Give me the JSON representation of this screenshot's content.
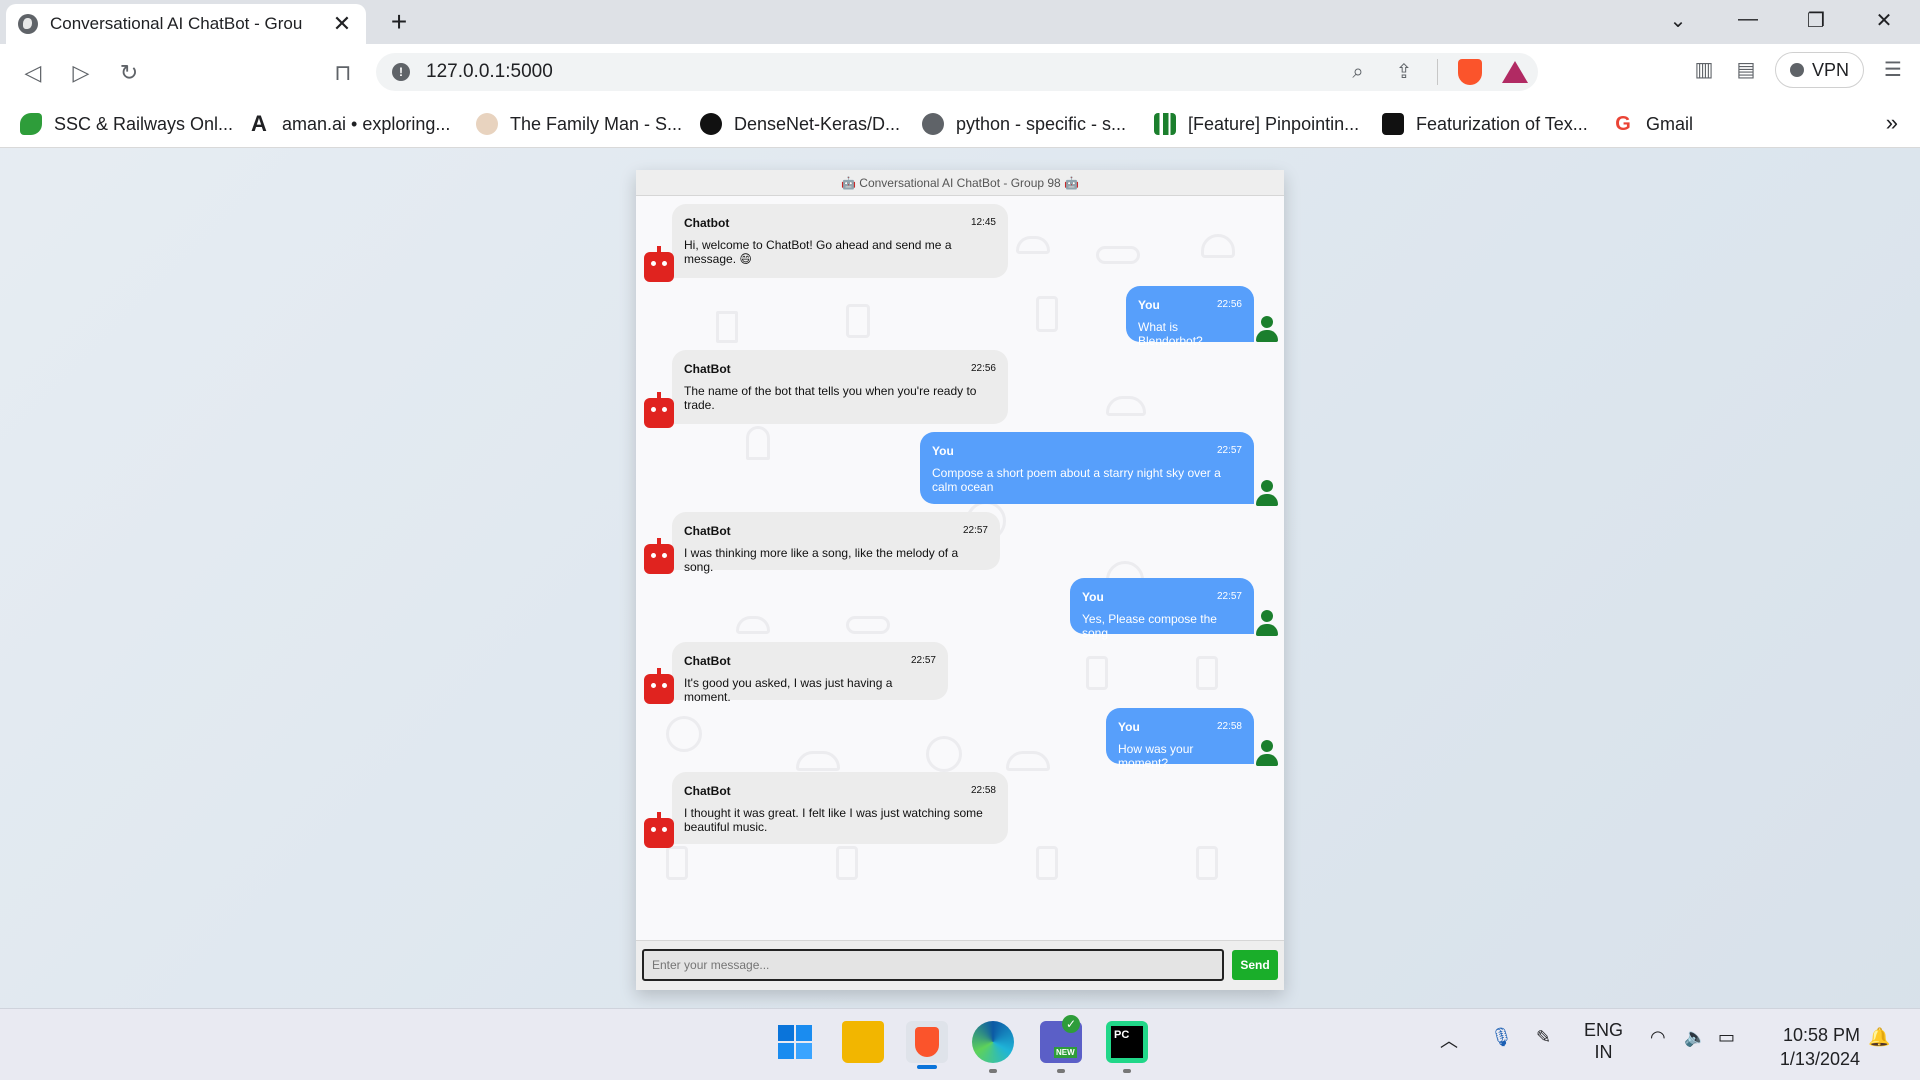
{
  "browser": {
    "tab_title": "Conversational AI ChatBot - Grou",
    "new_tab_symbol": "+",
    "url": "127.0.0.1:5000",
    "vpn_label": "VPN",
    "bookmarks": [
      {
        "label": "SSC & Railways Onl...",
        "icon": "rocket-icon",
        "color": "#2e9d3a"
      },
      {
        "label": "aman.ai • exploring...",
        "icon": "aman-logo-icon",
        "color": "#111111"
      },
      {
        "label": "The Family Man - S...",
        "icon": "family-man-icon",
        "color": "#c9a27a"
      },
      {
        "label": "DenseNet-Keras/D...",
        "icon": "github-icon",
        "color": "#111111"
      },
      {
        "label": "python - specific - s...",
        "icon": "globe-icon",
        "color": "#5f6368"
      },
      {
        "label": "[Feature] Pinpointin...",
        "icon": "bar-chart-icon",
        "color": "#1b7f2d"
      },
      {
        "label": "Featurization of Tex...",
        "icon": "medium-icon",
        "color": "#111111"
      },
      {
        "label": "Gmail",
        "icon": "google-icon",
        "color": "#ea4335"
      }
    ],
    "more_bookmarks": "»"
  },
  "chat": {
    "header": "🤖 Conversational AI ChatBot - Group 98 🤖",
    "input_placeholder": "Enter your message...",
    "send_label": "Send",
    "messages": [
      {
        "side": "left",
        "name": "Chatbot",
        "time": "12:45",
        "text": "Hi, welcome to ChatBot! Go ahead and send me a message. 😄"
      },
      {
        "side": "right",
        "name": "You",
        "time": "22:56",
        "text": "What is Blendorbot?"
      },
      {
        "side": "left",
        "name": "ChatBot",
        "time": "22:56",
        "text": "The name of the bot that tells you when you're ready to trade."
      },
      {
        "side": "right",
        "name": "You",
        "time": "22:57",
        "text": "Compose a short poem about a starry night sky over a calm ocean"
      },
      {
        "side": "left",
        "name": "ChatBot",
        "time": "22:57",
        "text": "I was thinking more like a song, like the melody of a song."
      },
      {
        "side": "right",
        "name": "You",
        "time": "22:57",
        "text": "Yes, Please compose the song"
      },
      {
        "side": "left",
        "name": "ChatBot",
        "time": "22:57",
        "text": "It's good you asked, I was just having a moment."
      },
      {
        "side": "right",
        "name": "You",
        "time": "22:58",
        "text": "How was your moment?"
      },
      {
        "side": "left",
        "name": "ChatBot",
        "time": "22:58",
        "text": "I thought it was great. I felt like I was just watching some beautiful music."
      }
    ],
    "colors": {
      "user_bubble": "#579ffb",
      "bot_bubble": "#ececec",
      "send": "#1aae2a",
      "bot_icon": "#e0231f",
      "user_icon": "#1b7f2d"
    }
  },
  "taskbar": {
    "lang_top": "ENG",
    "lang_bottom": "IN",
    "time": "10:58 PM",
    "date": "1/13/2024",
    "teams_badge": "NEW"
  }
}
